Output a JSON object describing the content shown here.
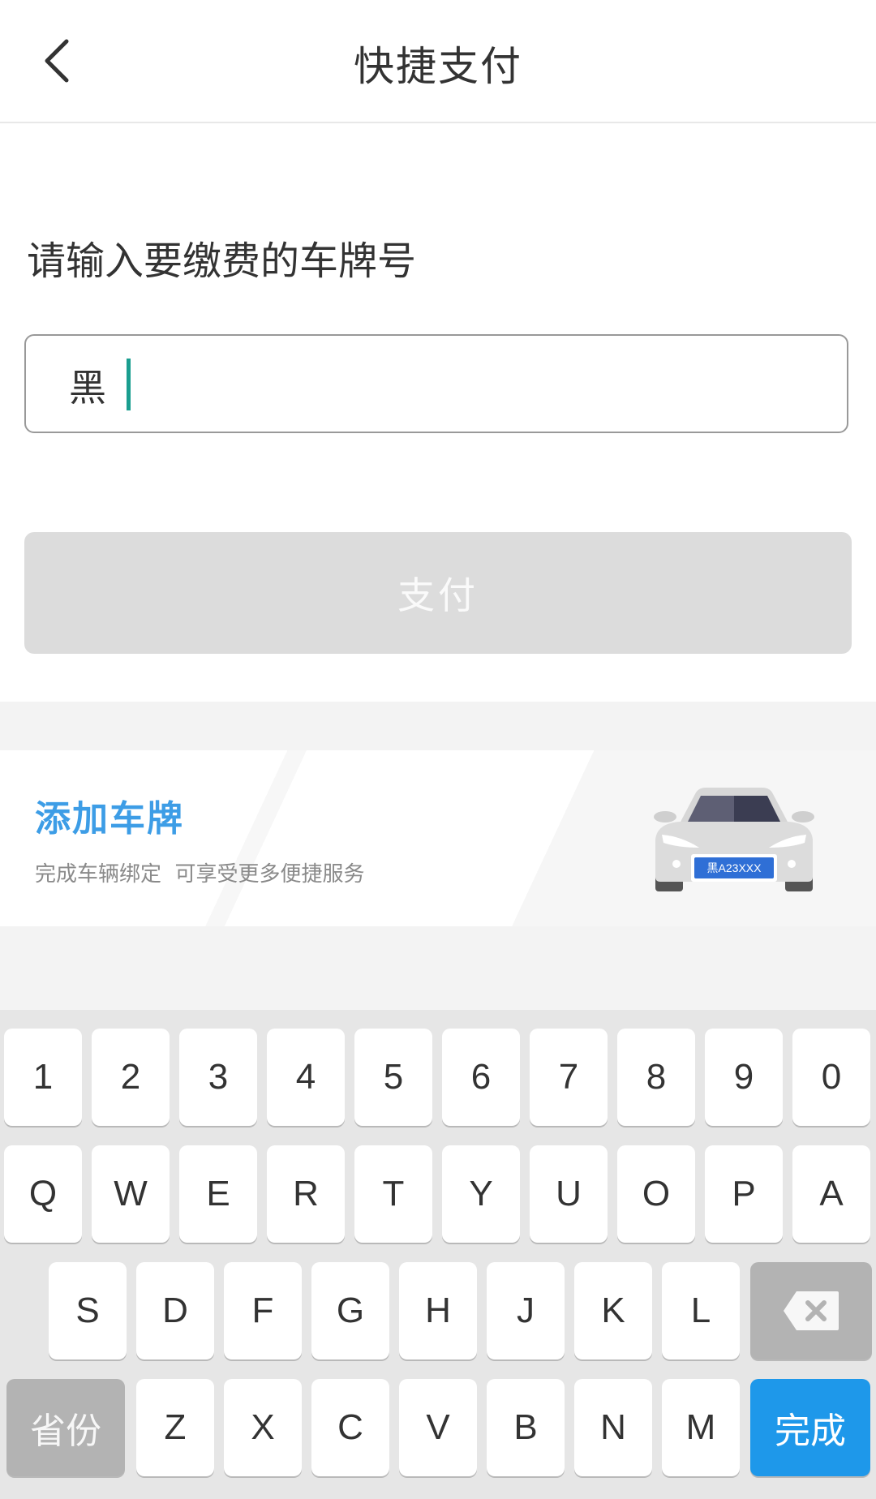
{
  "header": {
    "title": "快捷支付"
  },
  "form": {
    "prompt": "请输入要缴费的车牌号",
    "plate_prefix": "黑",
    "pay_button": "支付"
  },
  "banner": {
    "title": "添加车牌",
    "subtitle": "完成车辆绑定  可享受更多便捷服务",
    "plate_text": "黑A23XXX"
  },
  "keyboard": {
    "row1": [
      "1",
      "2",
      "3",
      "4",
      "5",
      "6",
      "7",
      "8",
      "9",
      "0"
    ],
    "row2": [
      "Q",
      "W",
      "E",
      "R",
      "T",
      "Y",
      "U",
      "O",
      "P",
      "A"
    ],
    "row3": [
      "S",
      "D",
      "F",
      "G",
      "H",
      "J",
      "K",
      "L"
    ],
    "row4": [
      "Z",
      "X",
      "C",
      "V",
      "B",
      "N",
      "M"
    ],
    "province_key": "省份",
    "done_key": "完成"
  },
  "colors": {
    "accent": "#3d9de6",
    "done_key": "#1e98ea",
    "caret": "#1a9e8f",
    "pay_disabled": "#dcdcdc"
  }
}
